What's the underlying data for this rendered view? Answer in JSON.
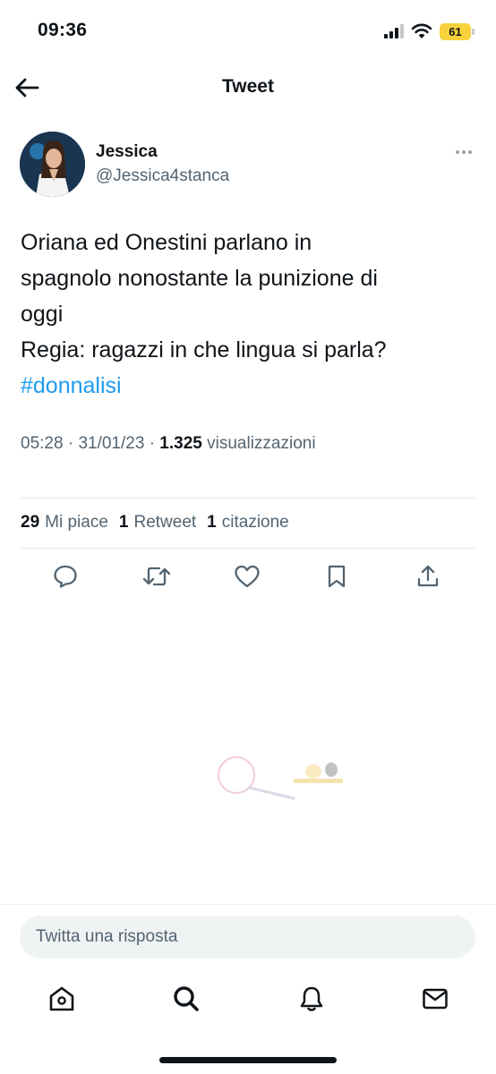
{
  "status_bar": {
    "time": "09:36",
    "battery": "61",
    "battery_color": "#f7d23c"
  },
  "header": {
    "title": "Tweet",
    "back_icon": "arrow-left-icon"
  },
  "tweet": {
    "author_name": "Jessica",
    "author_handle": "@Jessica4stanca",
    "text_lines": [
      "Oriana ed Onestini parlano in",
      "spagnolo nonostante la punizione di",
      "oggi",
      "Regia: ragazzi in che lingua si parla?"
    ],
    "hashtag": "#donnalisi",
    "time": "05:28",
    "date": "31/01/23",
    "separator": "·",
    "views_count": "1.325",
    "views_label": "visualizzazioni"
  },
  "stats": {
    "likes_count": "29",
    "likes_label": "Mi piace",
    "retweets_count": "1",
    "retweets_label": "Retweet",
    "quotes_count": "1",
    "quotes_label": "citazione"
  },
  "actions": [
    "reply-icon",
    "retweet-icon",
    "like-icon",
    "bookmark-icon",
    "share-icon"
  ],
  "reply": {
    "placeholder": "Twitta una risposta"
  },
  "tab_bar": [
    "home-icon",
    "search-icon",
    "notifications-icon",
    "messages-icon"
  ],
  "colors": {
    "accent": "#1d9bf0",
    "secondary_text": "#536471",
    "primary_text": "#0f1419"
  }
}
